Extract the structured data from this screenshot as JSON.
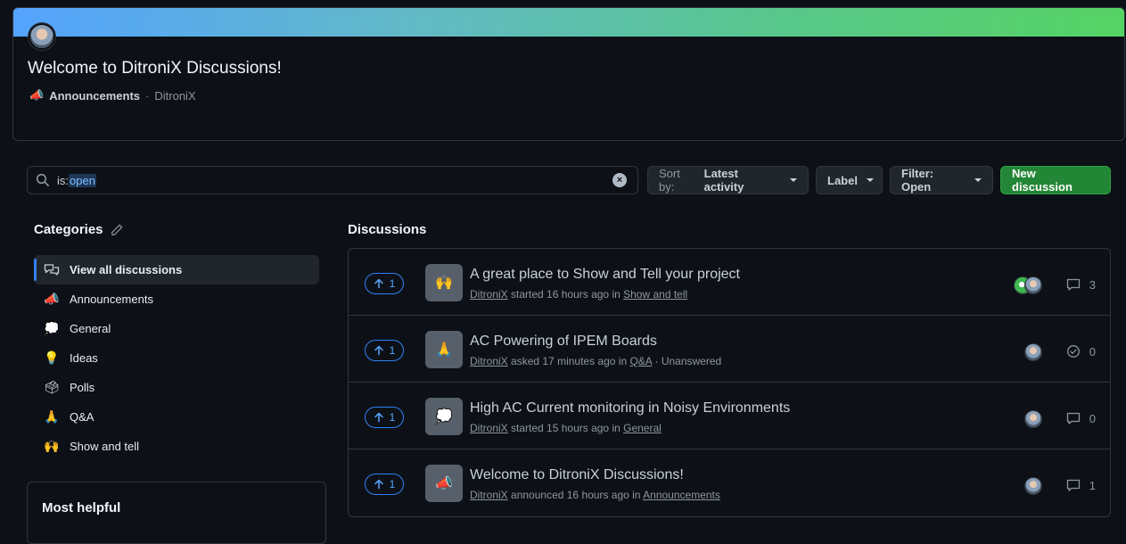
{
  "banner": {
    "title": "Welcome to DitroniX Discussions!",
    "category": "Announcements",
    "separator": "·",
    "author": "DitroniX"
  },
  "search": {
    "prefix": "is:",
    "value": "open",
    "clear_icon": "x-circle-icon"
  },
  "controls": {
    "sort_label": "Sort by:",
    "sort_value": "Latest activity",
    "label_button": "Label",
    "filter_button": "Filter: Open",
    "new_discussion": "New discussion"
  },
  "sidebar": {
    "title": "Categories",
    "items": [
      {
        "label": "View all discussions",
        "icon": "discussions-icon",
        "active": true
      },
      {
        "label": "Announcements",
        "icon": "megaphone-icon",
        "emoji": "📣"
      },
      {
        "label": "General",
        "icon": "speech-bubble-icon",
        "emoji": "💭"
      },
      {
        "label": "Ideas",
        "icon": "lightbulb-icon",
        "emoji": "💡"
      },
      {
        "label": "Polls",
        "icon": "ballot-box-icon",
        "emoji": "🗳"
      },
      {
        "label": "Q&A",
        "icon": "pray-icon",
        "emoji": "🙏"
      },
      {
        "label": "Show and tell",
        "icon": "raised-hands-icon",
        "emoji": "🙌"
      }
    ],
    "most_helpful": "Most helpful"
  },
  "discussions": {
    "title": "Discussions",
    "rows": [
      {
        "votes": "1",
        "emoji": "🙌",
        "title": "A great place to Show and Tell your project",
        "author": "DitroniX",
        "verb": "started 16 hours ago in",
        "category": "Show and tell",
        "extra": "",
        "count": "3",
        "count_icon": "comment-icon",
        "avatars": 2
      },
      {
        "votes": "1",
        "emoji": "🙏",
        "title": "AC Powering of IPEM Boards",
        "author": "DitroniX",
        "verb": "asked 17 minutes ago in",
        "category": "Q&A",
        "extra": "· Unanswered",
        "count": "0",
        "count_icon": "check-circle-icon",
        "avatars": 1
      },
      {
        "votes": "1",
        "emoji": "💭",
        "title": "High AC Current monitoring in Noisy Environments",
        "author": "DitroniX",
        "verb": "started 15 hours ago in",
        "category": "General",
        "extra": "",
        "count": "0",
        "count_icon": "comment-icon",
        "avatars": 1
      },
      {
        "votes": "1",
        "emoji": "📣",
        "title": "Welcome to DitroniX Discussions!",
        "author": "DitroniX",
        "verb": "announced 16 hours ago in",
        "category": "Announcements",
        "extra": "",
        "count": "1",
        "count_icon": "comment-icon",
        "avatars": 1
      }
    ]
  },
  "colors": {
    "accent": "#2f81f7",
    "primary_button": "#238636",
    "background": "#0d1117",
    "border": "#30363d"
  }
}
